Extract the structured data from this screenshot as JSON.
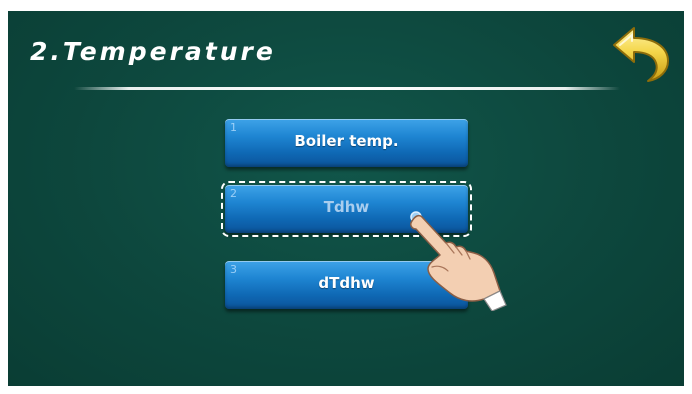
{
  "header": {
    "title": "2.Temperature"
  },
  "menu": {
    "items": [
      {
        "number": "1",
        "label": "Boiler temp.",
        "selected": false
      },
      {
        "number": "2",
        "label": "Tdhw",
        "selected": true
      },
      {
        "number": "3",
        "label": "dTdhw",
        "selected": false
      }
    ]
  },
  "icons": {
    "back": "back-arrow-icon",
    "pointer": "tap-hand-icon"
  },
  "colors": {
    "background": "#0e4a40",
    "button": "#1a7fcc",
    "back_arrow": "#f2d54a"
  }
}
